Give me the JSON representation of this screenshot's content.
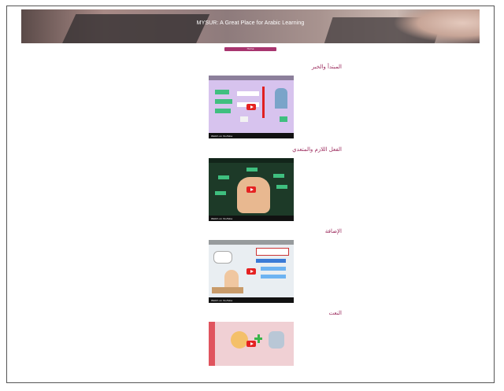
{
  "site": {
    "title": "MYSUR: A Great Place for Arabic Learning",
    "nav_button": "Home"
  },
  "sections": [
    {
      "heading": "المبتدأ والخبر"
    },
    {
      "heading": "الفعل اللازم والمتعدي"
    },
    {
      "heading": "الإضافة"
    },
    {
      "heading": "النعت"
    }
  ],
  "video": {
    "watch_label": "Watch on YouTube"
  },
  "colors": {
    "accent": "#a8356f",
    "heading": "#9b2a5c",
    "youtube_red": "#e52222"
  }
}
